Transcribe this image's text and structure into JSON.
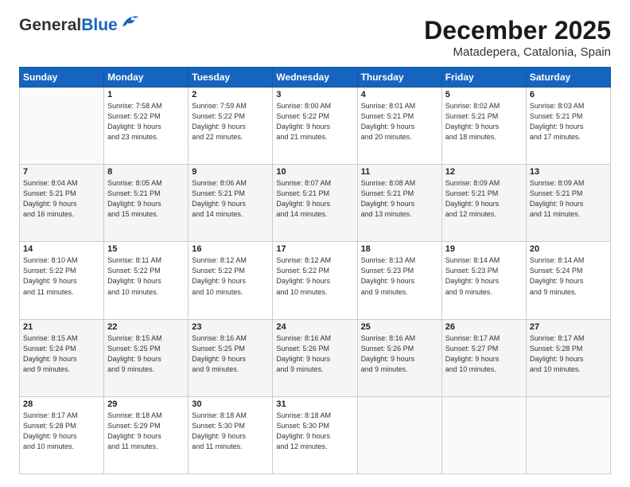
{
  "logo": {
    "line1": "General",
    "line2": "Blue"
  },
  "title": "December 2025",
  "location": "Matadepera, Catalonia, Spain",
  "days_of_week": [
    "Sunday",
    "Monday",
    "Tuesday",
    "Wednesday",
    "Thursday",
    "Friday",
    "Saturday"
  ],
  "weeks": [
    [
      {
        "day": "",
        "info": ""
      },
      {
        "day": "1",
        "info": "Sunrise: 7:58 AM\nSunset: 5:22 PM\nDaylight: 9 hours\nand 23 minutes."
      },
      {
        "day": "2",
        "info": "Sunrise: 7:59 AM\nSunset: 5:22 PM\nDaylight: 9 hours\nand 22 minutes."
      },
      {
        "day": "3",
        "info": "Sunrise: 8:00 AM\nSunset: 5:22 PM\nDaylight: 9 hours\nand 21 minutes."
      },
      {
        "day": "4",
        "info": "Sunrise: 8:01 AM\nSunset: 5:21 PM\nDaylight: 9 hours\nand 20 minutes."
      },
      {
        "day": "5",
        "info": "Sunrise: 8:02 AM\nSunset: 5:21 PM\nDaylight: 9 hours\nand 18 minutes."
      },
      {
        "day": "6",
        "info": "Sunrise: 8:03 AM\nSunset: 5:21 PM\nDaylight: 9 hours\nand 17 minutes."
      }
    ],
    [
      {
        "day": "7",
        "info": "Sunrise: 8:04 AM\nSunset: 5:21 PM\nDaylight: 9 hours\nand 16 minutes."
      },
      {
        "day": "8",
        "info": "Sunrise: 8:05 AM\nSunset: 5:21 PM\nDaylight: 9 hours\nand 15 minutes."
      },
      {
        "day": "9",
        "info": "Sunrise: 8:06 AM\nSunset: 5:21 PM\nDaylight: 9 hours\nand 14 minutes."
      },
      {
        "day": "10",
        "info": "Sunrise: 8:07 AM\nSunset: 5:21 PM\nDaylight: 9 hours\nand 14 minutes."
      },
      {
        "day": "11",
        "info": "Sunrise: 8:08 AM\nSunset: 5:21 PM\nDaylight: 9 hours\nand 13 minutes."
      },
      {
        "day": "12",
        "info": "Sunrise: 8:09 AM\nSunset: 5:21 PM\nDaylight: 9 hours\nand 12 minutes."
      },
      {
        "day": "13",
        "info": "Sunrise: 8:09 AM\nSunset: 5:21 PM\nDaylight: 9 hours\nand 11 minutes."
      }
    ],
    [
      {
        "day": "14",
        "info": "Sunrise: 8:10 AM\nSunset: 5:22 PM\nDaylight: 9 hours\nand 11 minutes."
      },
      {
        "day": "15",
        "info": "Sunrise: 8:11 AM\nSunset: 5:22 PM\nDaylight: 9 hours\nand 10 minutes."
      },
      {
        "day": "16",
        "info": "Sunrise: 8:12 AM\nSunset: 5:22 PM\nDaylight: 9 hours\nand 10 minutes."
      },
      {
        "day": "17",
        "info": "Sunrise: 8:12 AM\nSunset: 5:22 PM\nDaylight: 9 hours\nand 10 minutes."
      },
      {
        "day": "18",
        "info": "Sunrise: 8:13 AM\nSunset: 5:23 PM\nDaylight: 9 hours\nand 9 minutes."
      },
      {
        "day": "19",
        "info": "Sunrise: 8:14 AM\nSunset: 5:23 PM\nDaylight: 9 hours\nand 9 minutes."
      },
      {
        "day": "20",
        "info": "Sunrise: 8:14 AM\nSunset: 5:24 PM\nDaylight: 9 hours\nand 9 minutes."
      }
    ],
    [
      {
        "day": "21",
        "info": "Sunrise: 8:15 AM\nSunset: 5:24 PM\nDaylight: 9 hours\nand 9 minutes."
      },
      {
        "day": "22",
        "info": "Sunrise: 8:15 AM\nSunset: 5:25 PM\nDaylight: 9 hours\nand 9 minutes."
      },
      {
        "day": "23",
        "info": "Sunrise: 8:16 AM\nSunset: 5:25 PM\nDaylight: 9 hours\nand 9 minutes."
      },
      {
        "day": "24",
        "info": "Sunrise: 8:16 AM\nSunset: 5:26 PM\nDaylight: 9 hours\nand 9 minutes."
      },
      {
        "day": "25",
        "info": "Sunrise: 8:16 AM\nSunset: 5:26 PM\nDaylight: 9 hours\nand 9 minutes."
      },
      {
        "day": "26",
        "info": "Sunrise: 8:17 AM\nSunset: 5:27 PM\nDaylight: 9 hours\nand 10 minutes."
      },
      {
        "day": "27",
        "info": "Sunrise: 8:17 AM\nSunset: 5:28 PM\nDaylight: 9 hours\nand 10 minutes."
      }
    ],
    [
      {
        "day": "28",
        "info": "Sunrise: 8:17 AM\nSunset: 5:28 PM\nDaylight: 9 hours\nand 10 minutes."
      },
      {
        "day": "29",
        "info": "Sunrise: 8:18 AM\nSunset: 5:29 PM\nDaylight: 9 hours\nand 11 minutes."
      },
      {
        "day": "30",
        "info": "Sunrise: 8:18 AM\nSunset: 5:30 PM\nDaylight: 9 hours\nand 11 minutes."
      },
      {
        "day": "31",
        "info": "Sunrise: 8:18 AM\nSunset: 5:30 PM\nDaylight: 9 hours\nand 12 minutes."
      },
      {
        "day": "",
        "info": ""
      },
      {
        "day": "",
        "info": ""
      },
      {
        "day": "",
        "info": ""
      }
    ]
  ]
}
